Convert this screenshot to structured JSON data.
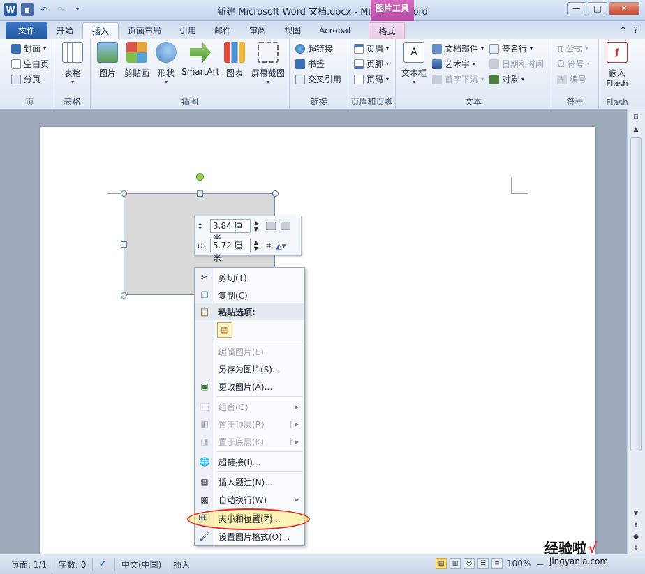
{
  "titlebar": {
    "title": "新建 Microsoft Word 文档.docx - Microsoft Word",
    "context_tab_title": "图片工具",
    "minimize": "—",
    "maximize": "□",
    "close": "✕"
  },
  "tabs": [
    "文件",
    "开始",
    "插入",
    "页面布局",
    "引用",
    "邮件",
    "审阅",
    "视图",
    "Acrobat",
    "格式"
  ],
  "ribbon": {
    "page_group": {
      "label": "页",
      "items": [
        "封面",
        "空白页",
        "分页"
      ]
    },
    "table_group": {
      "label": "表格",
      "button": "表格"
    },
    "illustrations_group": {
      "label": "插图",
      "buttons": [
        "图片",
        "剪贴画",
        "形状",
        "SmartArt",
        "图表",
        "屏幕截图"
      ]
    },
    "links_group": {
      "label": "链接",
      "items": [
        "超链接",
        "书签",
        "交叉引用"
      ]
    },
    "header_footer_group": {
      "label": "页眉和页脚",
      "items": [
        "页眉",
        "页脚",
        "页码"
      ]
    },
    "text_group": {
      "label": "文本",
      "textbox": "文本框",
      "items": [
        "文档部件",
        "艺术字",
        "首字下沉"
      ],
      "items2": [
        "签名行",
        "日期和时间",
        "对象"
      ]
    },
    "symbols_group": {
      "label": "符号",
      "items": [
        "公式",
        "符号",
        "编号"
      ]
    },
    "flash_group": {
      "label": "Flash",
      "button_line1": "嵌入",
      "button_line2": "Flash"
    }
  },
  "mini_toolbar": {
    "height_value": "3.84 厘米",
    "width_value": "5.72 厘米"
  },
  "context_menu": {
    "items": [
      {
        "label": "剪切(T)",
        "icon": "scissors-icon",
        "disabled": false
      },
      {
        "label": "复制(C)",
        "icon": "copy-icon",
        "disabled": false
      },
      {
        "label": "粘贴选项:",
        "icon": "paste-icon",
        "disabled": false
      },
      {
        "label": "编辑图片(E)",
        "icon": "",
        "disabled": true
      },
      {
        "label": "另存为图片(S)...",
        "icon": "",
        "disabled": false
      },
      {
        "label": "更改图片(A)...",
        "icon": "change-picture-icon",
        "disabled": false
      },
      {
        "label": "组合(G)",
        "icon": "group-icon",
        "disabled": true
      },
      {
        "label": "置于顶层(R)",
        "icon": "bring-front-icon",
        "disabled": true
      },
      {
        "label": "置于底层(K)",
        "icon": "send-back-icon",
        "disabled": true
      },
      {
        "label": "超链接(I)...",
        "icon": "hyperlink-icon",
        "disabled": false
      },
      {
        "label": "插入题注(N)...",
        "icon": "caption-icon",
        "disabled": false
      },
      {
        "label": "自动换行(W)",
        "icon": "wrap-icon",
        "disabled": false
      },
      {
        "label": "大小和位置(Z)...",
        "icon": "size-position-icon",
        "disabled": false
      },
      {
        "label": "设置图片格式(O)...",
        "icon": "format-picture-icon",
        "disabled": false
      }
    ]
  },
  "statusbar": {
    "page": "页面: 1/1",
    "words": "字数: 0",
    "language": "中文(中国)",
    "mode": "插入",
    "zoom": "100%",
    "zoom_minus": "－",
    "zoom_plus": "＋"
  },
  "watermark": {
    "main": "经验啦",
    "check": "√",
    "sub": "jingyanla.com"
  },
  "colors": {
    "file_tab": "#2457a4",
    "context_tab": "#b44aa3",
    "highlight_ring": "#e52b2b"
  }
}
